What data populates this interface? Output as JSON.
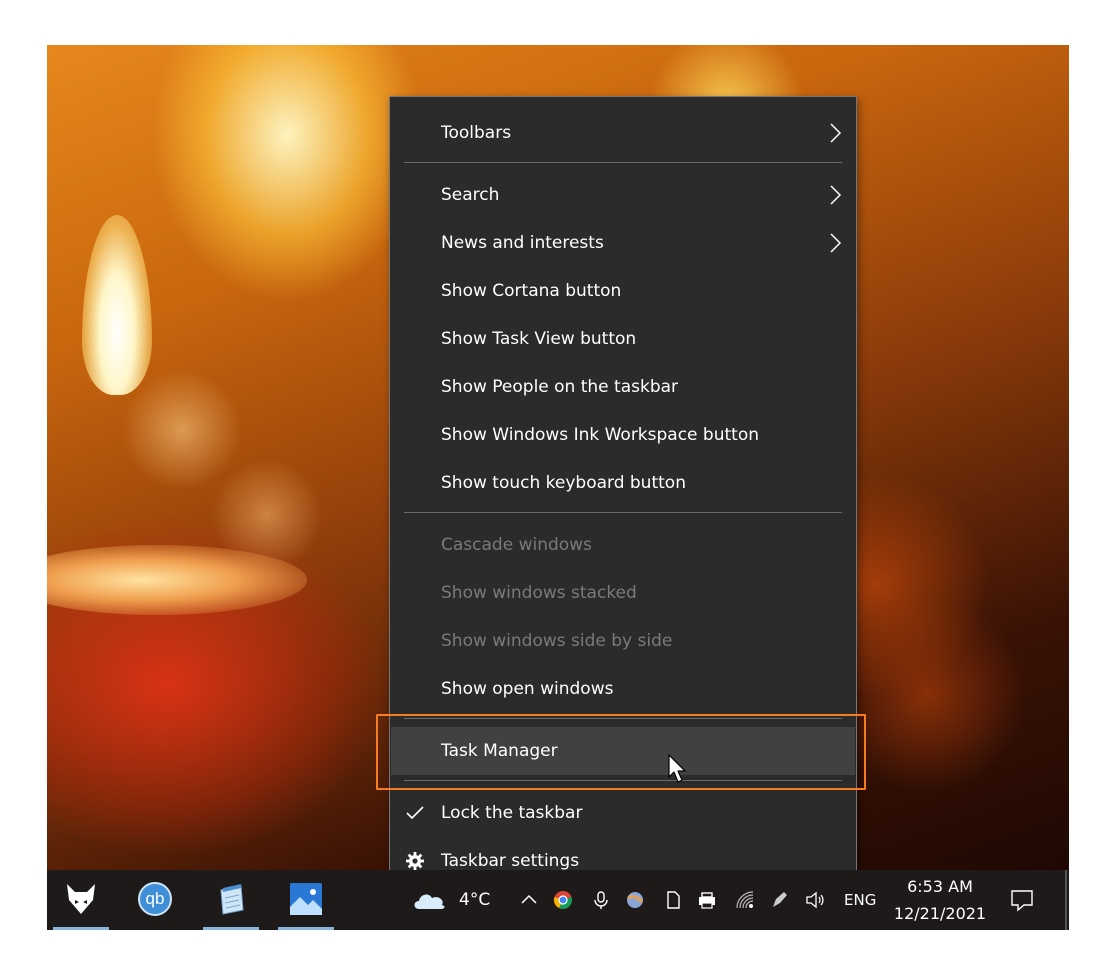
{
  "menu": {
    "items": [
      {
        "label": "Toolbars",
        "submenu": true
      },
      {
        "label": "Search",
        "submenu": true
      },
      {
        "label": "News and interests",
        "submenu": true
      },
      {
        "label": "Show Cortana button"
      },
      {
        "label": "Show Task View button"
      },
      {
        "label": "Show People on the taskbar"
      },
      {
        "label": "Show Windows Ink Workspace button"
      },
      {
        "label": "Show touch keyboard button"
      },
      {
        "label": "Cascade windows",
        "disabled": true
      },
      {
        "label": "Show windows stacked",
        "disabled": true
      },
      {
        "label": "Show windows side by side",
        "disabled": true
      },
      {
        "label": "Show open windows"
      },
      {
        "label": "Task Manager",
        "highlighted": true
      },
      {
        "label": "Lock the taskbar",
        "checked": true
      },
      {
        "label": "Taskbar settings",
        "icon": "gear-icon"
      }
    ]
  },
  "taskbar": {
    "apps": [
      {
        "name": "fox-app-icon",
        "active": true
      },
      {
        "name": "qbittorrent-icon",
        "text": "qb",
        "active": false
      },
      {
        "name": "notepad-app-icon",
        "active": true
      },
      {
        "name": "photos-app-icon",
        "active": true
      }
    ],
    "weather": {
      "temp": "4°C",
      "icon": "cloud-icon"
    },
    "tray_icons": [
      "chevron-up-icon",
      "chrome-icon",
      "mic-icon",
      "globe-icon",
      "document-icon",
      "printer-icon",
      "wifi-icon",
      "pen-icon",
      "volume-icon"
    ],
    "language": "ENG",
    "time": "6:53 AM",
    "date": "12/21/2021",
    "notification_icon": "notification-icon"
  },
  "colors": {
    "menu_bg": "#2b2b2b",
    "hover_bg": "#414141",
    "highlight_border": "#f57c1f",
    "disabled_text": "#7a7a7a",
    "taskbar_bg": "#1e1a19"
  }
}
